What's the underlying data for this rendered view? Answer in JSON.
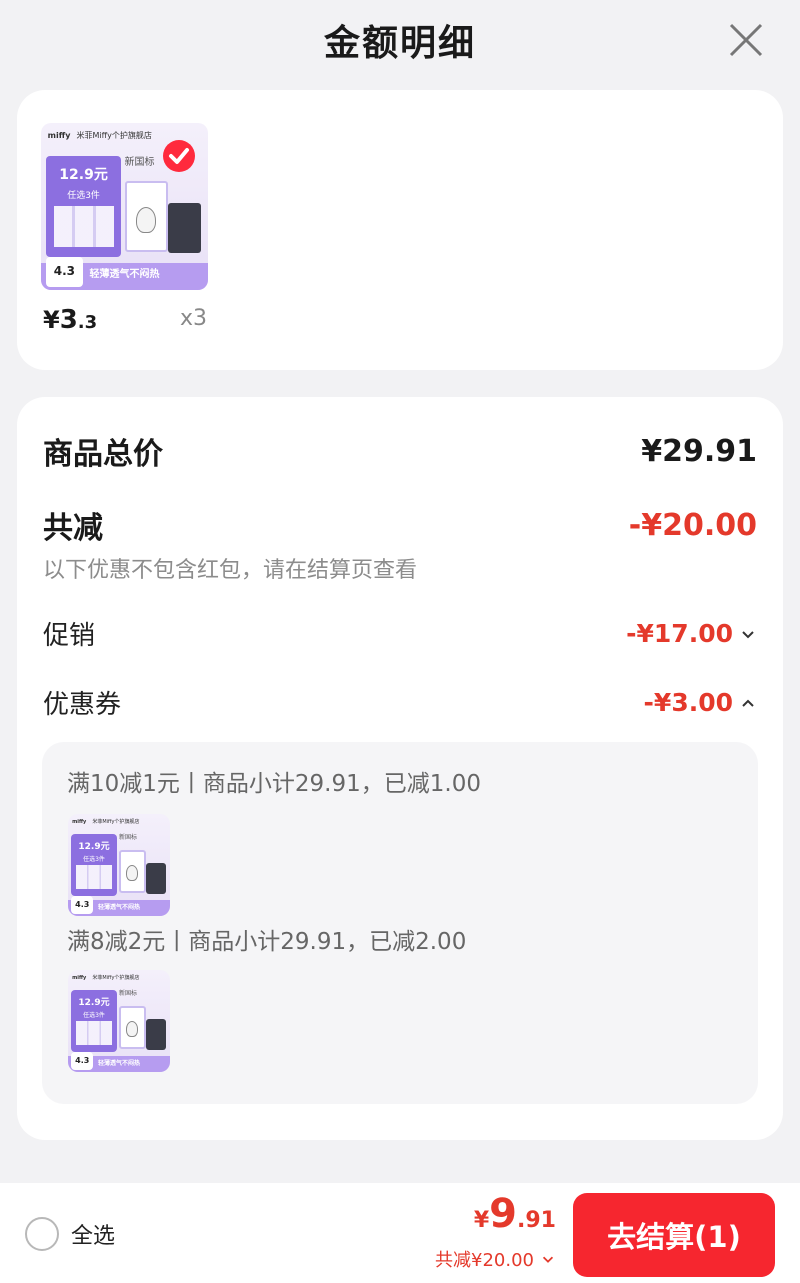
{
  "header": {
    "title": "金额明细"
  },
  "product": {
    "image": {
      "brand": "miffy",
      "shop": "米菲Miffy个护旗舰店",
      "promo_price": "12.9元",
      "promo_sub": "任选3件",
      "tag": "新国标",
      "strip": "轻薄透气不闷热",
      "rating": "4.3"
    },
    "price_currency": "¥",
    "price_int": "3",
    "price_dec": ".3",
    "quantity": "x3"
  },
  "detail": {
    "total_label": "商品总价",
    "total_value": "¥29.91",
    "discount_label": "共减",
    "discount_value": "-¥20.00",
    "note": "以下优惠不包含红包，请在结算页查看",
    "promo_label": "促销",
    "promo_value": "-¥17.00",
    "coupon_label": "优惠券",
    "coupon_value": "-¥3.00",
    "coupons": [
      {
        "rule": "满10减1元丨商品小计29.91，已减1.00"
      },
      {
        "rule": "满8减2元丨商品小计29.91，已减2.00"
      }
    ]
  },
  "bottom": {
    "select_all": "全选",
    "price_currency": "¥",
    "price_int": "9",
    "price_dec": ".91",
    "saving": "共减¥20.00",
    "checkout": "去结算(1)"
  },
  "colors": {
    "accent": "#f6262f",
    "discount_red": "#e4392b"
  }
}
